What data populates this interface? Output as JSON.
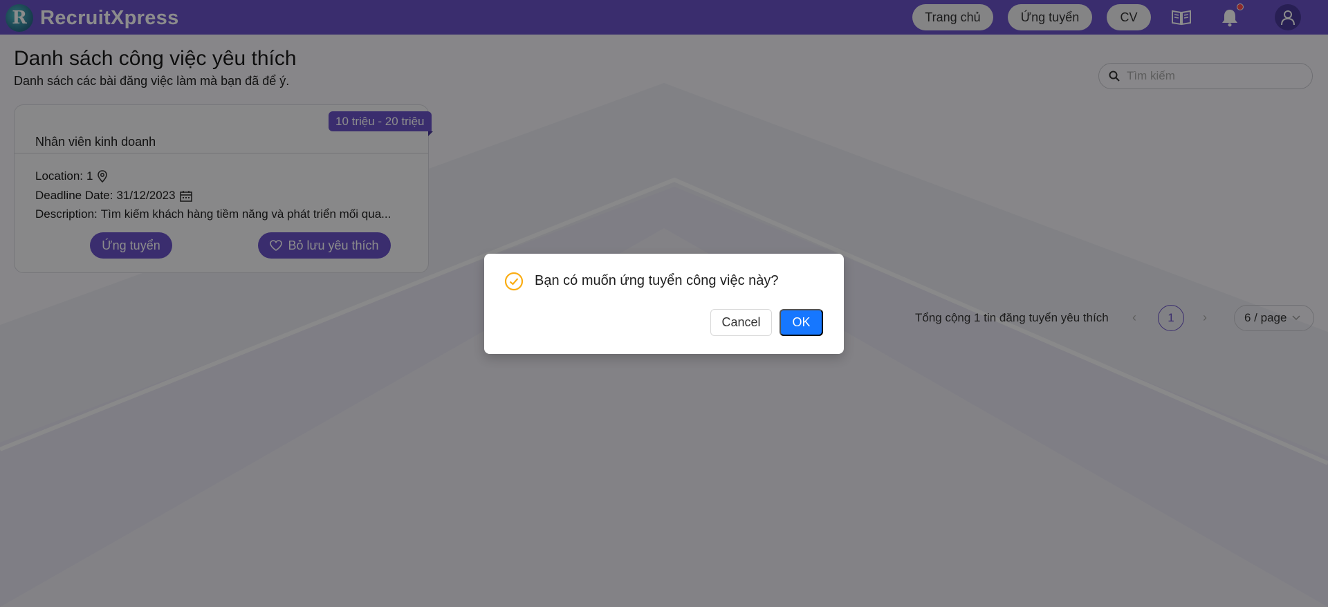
{
  "app": {
    "brand": "RecruitXpress",
    "logo_letter": "R"
  },
  "nav": {
    "home": "Trang chủ",
    "apply": "Ứng tuyển",
    "cv": "CV",
    "icons": [
      "book-icon",
      "bell-icon",
      "user-icon"
    ]
  },
  "page": {
    "title": "Danh sách công việc yêu thích",
    "subtitle": "Danh sách các bài đăng việc làm mà bạn đã để ý."
  },
  "search": {
    "placeholder": "Tìm kiếm",
    "value": ""
  },
  "job": {
    "salary": "10 triệu - 20 triệu",
    "title": "Nhân viên kinh doanh",
    "location_label": "Location:",
    "location_value": "1",
    "deadline_label": "Deadline Date:",
    "deadline_value": "31/12/2023",
    "description_label": "Description:",
    "description_value": "Tìm kiếm khách hàng tiềm năng và phát triển mối qua...",
    "apply_btn": "Ứng tuyển",
    "unsave_btn": "Bỏ lưu yêu thích"
  },
  "pagination": {
    "total": "Tổng cộng 1 tin đăng tuyển yêu thích",
    "current": "1",
    "page_size": "6 / page"
  },
  "modal": {
    "title": "Bạn có muốn ứng tuyển công việc này?",
    "cancel": "Cancel",
    "ok": "OK"
  },
  "colors": {
    "brand": "#6b53c9",
    "primary": "#1677ff",
    "warning": "#faad14"
  }
}
